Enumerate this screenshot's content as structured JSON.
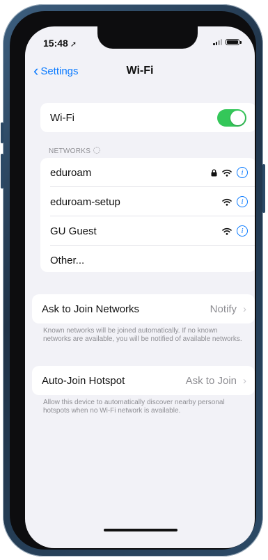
{
  "status": {
    "time": "15:48",
    "location_arrow": "➚"
  },
  "nav": {
    "back_label": "Settings",
    "title": "Wi-Fi"
  },
  "wifi": {
    "label": "Wi-Fi",
    "enabled": true,
    "toggle_color": "#34c759"
  },
  "networks": {
    "header": "NETWORKS",
    "items": [
      {
        "name": "eduroam",
        "locked": true
      },
      {
        "name": "eduroam-setup",
        "locked": false
      },
      {
        "name": "GU Guest",
        "locked": false
      }
    ],
    "other_label": "Other..."
  },
  "ask_to_join": {
    "label": "Ask to Join Networks",
    "value": "Notify",
    "footnote": "Known networks will be joined automatically. If no known networks are available, you will be notified of available networks."
  },
  "auto_join": {
    "label": "Auto-Join Hotspot",
    "value": "Ask to Join",
    "footnote": "Allow this device to automatically discover nearby personal hotspots when no Wi-Fi network is available."
  },
  "colors": {
    "accent": "#0a7aff",
    "background": "#f2f2f7",
    "phone_frame": "#2c4a66"
  }
}
